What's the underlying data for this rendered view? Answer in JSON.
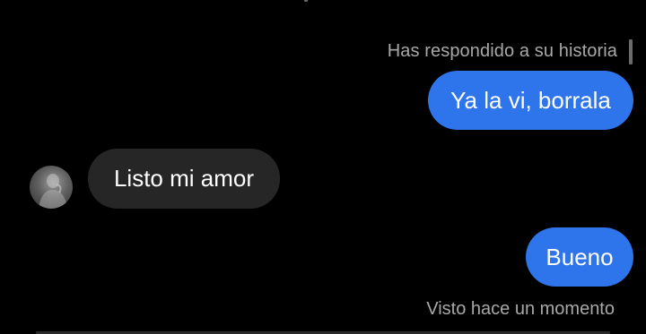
{
  "conversation": {
    "story_reply_label": "Has respondido a su historia",
    "messages": [
      {
        "sender": "me",
        "text": "Ya la vi, borrala"
      },
      {
        "sender": "them",
        "text": "Listo mi amor"
      },
      {
        "sender": "me",
        "text": "Bueno"
      }
    ],
    "seen_status": "Visto hace un momento"
  },
  "contact": {
    "avatar_icon": "user-avatar-icon"
  },
  "colors": {
    "background": "#000000",
    "sent_bubble": "#2e74ea",
    "received_bubble": "#262626",
    "meta_text": "#a8a8a8"
  }
}
